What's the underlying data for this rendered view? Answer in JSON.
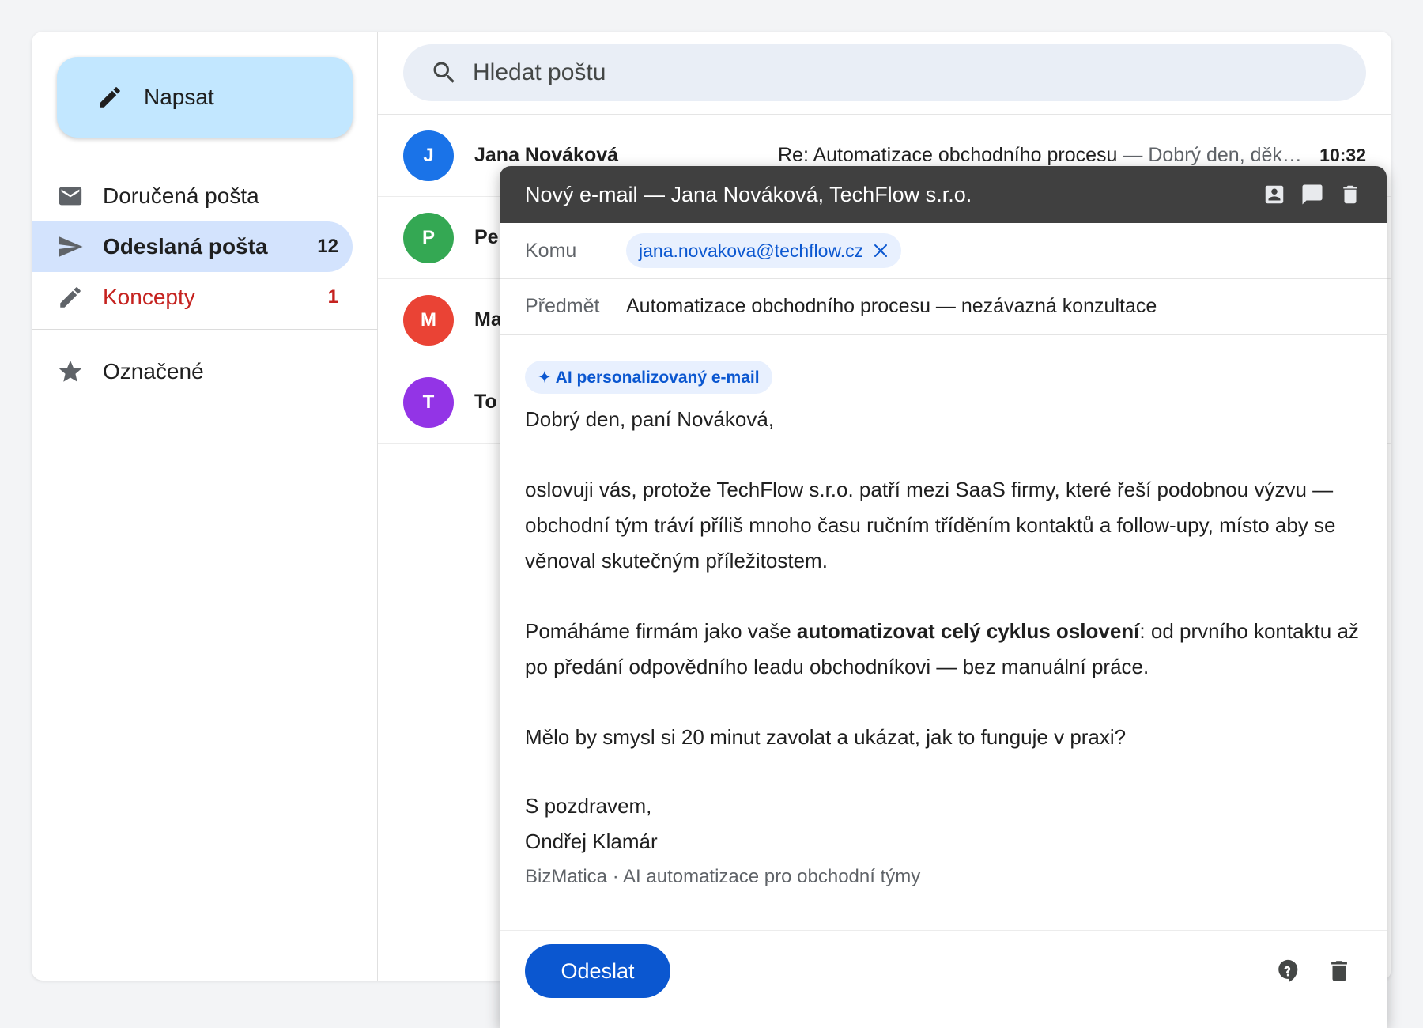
{
  "sidebar": {
    "compose_label": "Napsat",
    "items": [
      {
        "label": "Doručená pošta",
        "icon": "inbox-icon"
      },
      {
        "label": "Odeslaná pošta",
        "count": "12",
        "icon": "send-icon"
      },
      {
        "label": "Koncepty",
        "count": "1",
        "icon": "pencil-icon"
      },
      {
        "label": "Označené",
        "icon": "star-icon"
      }
    ]
  },
  "search": {
    "placeholder": "Hledat poštu"
  },
  "mail_list": [
    {
      "initial": "J",
      "color": "#1a73e8",
      "sender": "Jana Nováková",
      "subject": "Re: Automatizace obchodního procesu",
      "snippet": " — Dobrý den, děk…",
      "time": "10:32"
    },
    {
      "initial": "P",
      "color": "#34a853",
      "sender": "Pe"
    },
    {
      "initial": "M",
      "color": "#ea4335",
      "sender": "Ma"
    },
    {
      "initial": "T",
      "color": "#9334e6",
      "sender": "To"
    }
  ],
  "compose": {
    "title": "Nový e-mail — Jana Nováková, TechFlow s.r.o.",
    "to_label": "Komu",
    "to_value": "jana.novakova@techflow.cz",
    "subject_label": "Předmět",
    "subject_value": "Automatizace obchodního procesu — nezávazná konzultace",
    "ai_badge": "✦ AI personalizovaný e-mail",
    "greeting": "Dobrý den, paní Nováková,",
    "para1": "oslovuji vás, protože TechFlow s.r.o. patří mezi SaaS firmy, které řeší podobnou výzvu — obchodní tým tráví příliš mnoho času ručním tříděním kontaktů a follow-upy, místo aby se věnoval skutečným příležitostem.",
    "para2_before": "Pomáháme firmám jako vaše ",
    "para2_bold": "automatizovat celý cyklus oslovení",
    "para2_after": ": od prvního kontaktu až po předání odpovědního leadu obchodníkovi — bez manuální práce.",
    "para3": "Mělo by smysl si 20 minut zavolat a ukázat, jak to funguje v praxi?",
    "signoff": "S pozdravem,",
    "signature_name": "Ondřej Klamár",
    "signature_company": "BizMatica · AI automatizace pro obchodní týmy",
    "send_label": "Odeslat"
  },
  "colors": {
    "compose_bg": "#c2e7ff",
    "active_nav": "#d3e3fd",
    "drafts_red": "#c5221f",
    "primary_blue": "#0b57d0",
    "header_dark": "#404040"
  }
}
